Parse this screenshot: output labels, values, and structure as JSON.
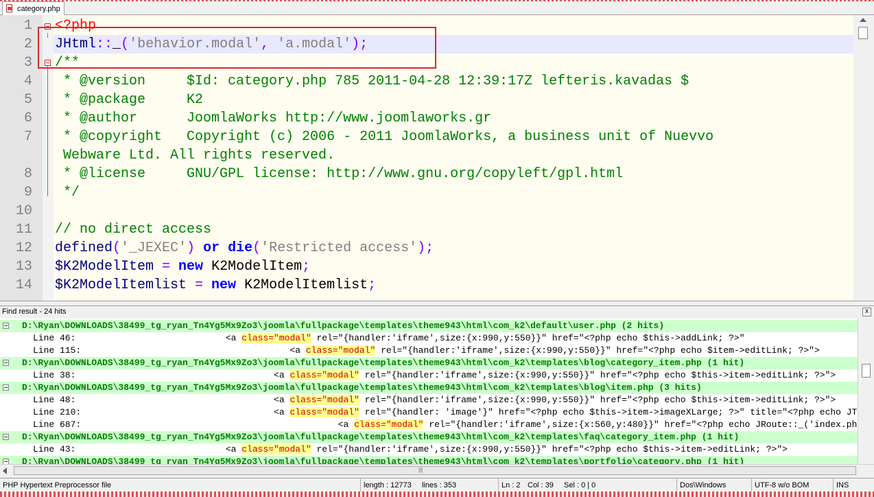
{
  "tab": {
    "label": "category.php"
  },
  "editor": {
    "lines": [
      {
        "num": "1",
        "tokens": [
          {
            "t": "<?php",
            "c": "phptag"
          }
        ]
      },
      {
        "num": "2",
        "tokens": [
          {
            "t": "JHtml",
            "c": "fn"
          },
          {
            "t": "::",
            "c": "op"
          },
          {
            "t": "_",
            "c": ""
          },
          {
            "t": "(",
            "c": "op"
          },
          {
            "t": "'behavior.modal'",
            "c": "st"
          },
          {
            "t": ", ",
            "c": "op"
          },
          {
            "t": "'a.modal'",
            "c": "st"
          },
          {
            "t": ");",
            "c": "op"
          }
        ]
      },
      {
        "num": "3",
        "tokens": [
          {
            "t": "/**",
            "c": "cm"
          }
        ]
      },
      {
        "num": "4",
        "tokens": [
          {
            "t": " * @version     $Id: category.php 785 2011-04-28 12:39:17Z lefteris.kavadas $",
            "c": "cm"
          }
        ]
      },
      {
        "num": "5",
        "tokens": [
          {
            "t": " * @package     K2",
            "c": "cm"
          }
        ]
      },
      {
        "num": "6",
        "tokens": [
          {
            "t": " * @author      JoomlaWorks http://www.joomlaworks.gr",
            "c": "cm"
          }
        ]
      },
      {
        "num": "7",
        "tokens": [
          {
            "t": " * @copyright   Copyright (c) 2006 - 2011 JoomlaWorks, a business unit of Nuevvo",
            "c": "cm"
          }
        ]
      },
      {
        "num": "",
        "cont": true,
        "tokens": [
          {
            "t": "Webware Ltd. All rights reserved.",
            "c": "cm"
          }
        ]
      },
      {
        "num": "8",
        "tokens": [
          {
            "t": " * @license     GNU/GPL license: http://www.gnu.org/copyleft/gpl.html",
            "c": "cm"
          }
        ]
      },
      {
        "num": "9",
        "tokens": [
          {
            "t": " */",
            "c": "cm"
          }
        ]
      },
      {
        "num": "10",
        "tokens": []
      },
      {
        "num": "11",
        "tokens": [
          {
            "t": "// no direct access",
            "c": "cm"
          }
        ]
      },
      {
        "num": "12",
        "tokens": [
          {
            "t": "defined",
            "c": "fn"
          },
          {
            "t": "(",
            "c": "op"
          },
          {
            "t": "'_JEXEC'",
            "c": "st"
          },
          {
            "t": ") ",
            "c": "op"
          },
          {
            "t": "or",
            "c": "kw"
          },
          {
            "t": " ",
            "c": ""
          },
          {
            "t": "die",
            "c": "kw"
          },
          {
            "t": "(",
            "c": "op"
          },
          {
            "t": "'Restricted access'",
            "c": "st"
          },
          {
            "t": ");",
            "c": "op"
          }
        ]
      },
      {
        "num": "13",
        "tokens": [
          {
            "t": "$K2ModelItem",
            "c": "vr"
          },
          {
            "t": " = ",
            "c": "op"
          },
          {
            "t": "new",
            "c": "kw"
          },
          {
            "t": " K2ModelItem",
            "c": ""
          },
          {
            "t": ";",
            "c": "op"
          }
        ]
      },
      {
        "num": "14",
        "tokens": [
          {
            "t": "$K2ModelItemlist",
            "c": "vr"
          },
          {
            "t": " = ",
            "c": "op"
          },
          {
            "t": "new",
            "c": "kw"
          },
          {
            "t": " K2ModelItemlist",
            "c": ""
          },
          {
            "t": ";",
            "c": "op"
          }
        ]
      }
    ]
  },
  "find": {
    "title": "Find result - 24 hits",
    "close_label": "x",
    "rows": [
      {
        "type": "file",
        "text": "D:\\Ryan\\DOWNLOADS\\38499_tg_ryan_Tn4Yg5Mx9Zo3\\joomla\\fullpackage\\templates\\theme943\\html\\com_k2\\default\\user.php (2 hits)"
      },
      {
        "type": "hit",
        "line": "Line 46:",
        "pre": "                <a ",
        "match": "class=\"modal\"",
        "post": " rel=\"{handler:'iframe',size:{x:990,y:550}}\" href=\"<?php echo $this->addLink; ?>\""
      },
      {
        "type": "hit",
        "line": "Line 115:",
        "pre": "                            <a ",
        "match": "class=\"modal\"",
        "post": " rel=\"{handler:'iframe',size:{x:990,y:550}}\" href=\"<?php echo $item->editLink; ?>\">"
      },
      {
        "type": "file",
        "text": "D:\\Ryan\\DOWNLOADS\\38499_tg_ryan_Tn4Yg5Mx9Zo3\\joomla\\fullpackage\\templates\\theme943\\html\\com_k2\\templates\\blog\\category_item.php (1 hit)"
      },
      {
        "type": "hit",
        "line": "Line 38:",
        "pre": "                         <a ",
        "match": "class=\"modal\"",
        "post": " rel=\"{handler:'iframe',size:{x:990,y:550}}\" href=\"<?php echo $this->item->editLink; ?>\">"
      },
      {
        "type": "file",
        "text": "D:\\Ryan\\DOWNLOADS\\38499_tg_ryan_Tn4Yg5Mx9Zo3\\joomla\\fullpackage\\templates\\theme943\\html\\com_k2\\templates\\blog\\item.php (3 hits)"
      },
      {
        "type": "hit",
        "line": "Line 48:",
        "pre": "                         <a ",
        "match": "class=\"modal\"",
        "post": " rel=\"{handler:'iframe',size:{x:990,y:550}}\" href=\"<?php echo $this->item->editLink; ?>\">"
      },
      {
        "type": "hit",
        "line": "Line 210:",
        "pre": "                         <a ",
        "match": "class=\"modal\"",
        "post": " rel=\"{handler: 'image'}\" href=\"<?php echo $this->item->imageXLarge; ?>\" title=\"<?php echo JText::_('K"
      },
      {
        "type": "hit",
        "line": "Line 687:",
        "pre": "                                     <a ",
        "match": "class=\"modal\"",
        "post": " rel=\"{handler:'iframe',size:{x:560,y:480}}\" href=\"<?php echo JRoute::_('index.php?option="
      },
      {
        "type": "file",
        "text": "D:\\Ryan\\DOWNLOADS\\38499_tg_ryan_Tn4Yg5Mx9Zo3\\joomla\\fullpackage\\templates\\theme943\\html\\com_k2\\templates\\faq\\category_item.php (1 hit)"
      },
      {
        "type": "hit",
        "line": "Line 43:",
        "pre": "                <a ",
        "match": "class=\"modal\"",
        "post": " rel=\"{handler:'iframe',size:{x:990,y:550}}\" href=\"<?php echo $this->item->editLink; ?>\">"
      },
      {
        "type": "file",
        "text": "D:\\Ryan\\DOWNLOADS\\38499_tg_ryan_Tn4Yg5Mx9Zo3\\joomla\\fullpackage\\templates\\theme943\\html\\com_k2\\templates\\portfolio\\category.php (1 hit)"
      }
    ]
  },
  "status": {
    "filetype": "PHP Hypertext Preprocessor file",
    "length": "length : 12773",
    "lines": "lines : 353",
    "ln": "Ln : 2",
    "col": "Col : 39",
    "sel": "Sel : 0 | 0",
    "eol": "Dos\\Windows",
    "encoding": "UTF-8 w/o BOM",
    "mode": "INS"
  },
  "colors": {
    "comment": "#008000",
    "keyword": "#0000ff",
    "string": "#808080",
    "operator": "#8000ff",
    "match_bg": "#ffff90",
    "file_row_bg": "#ceffce",
    "annotation_box": "#d32a2a"
  }
}
